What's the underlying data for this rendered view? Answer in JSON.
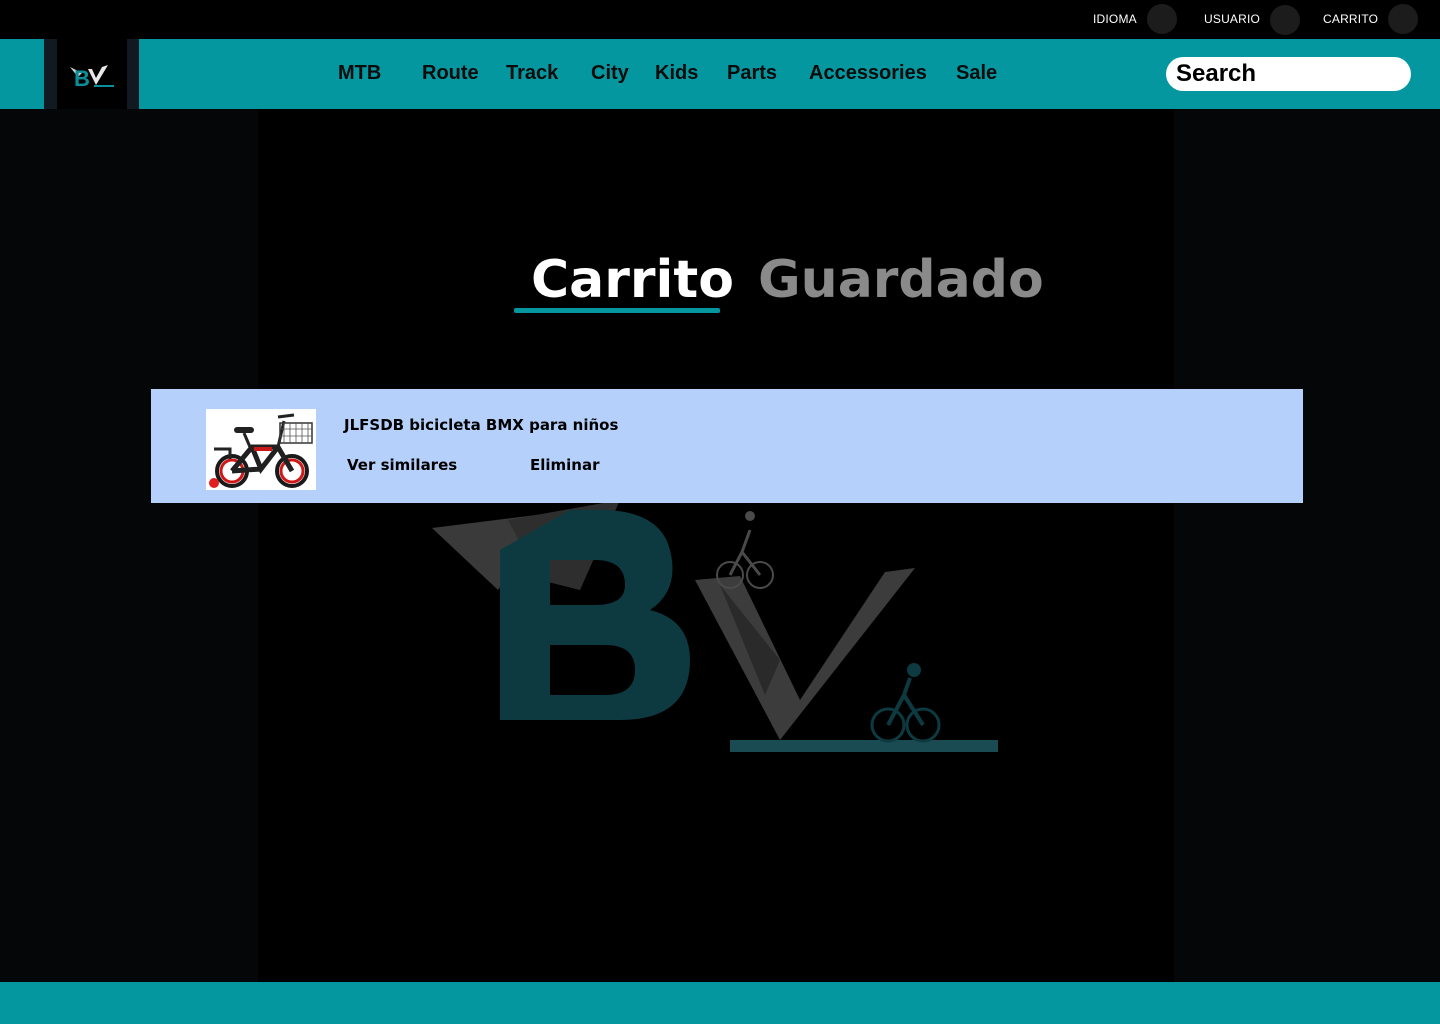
{
  "utility_bar": {
    "language_label": "IDIOMA",
    "user_label": "USUARIO",
    "cart_label": "CARRITO"
  },
  "nav": {
    "logo_icon": "bv-logo-icon",
    "links": [
      "MTB",
      "Route",
      "Track",
      "City",
      "Kids",
      "Parts",
      "Accessories",
      "Sale"
    ],
    "search_placeholder": "Search"
  },
  "tabs": {
    "cart": "Carrito",
    "saved": "Guardado",
    "active": "cart"
  },
  "cart_items": [
    {
      "name": "JLFSDB bicicleta BMX para niños",
      "image_icon": "kids-bike-image",
      "actions": {
        "similar": "Ver similares",
        "remove": "Eliminar"
      }
    }
  ],
  "colors": {
    "accent": "#05979f",
    "panel": "#b4d0fb",
    "background": "#000000",
    "inactive_tab": "#8a8a8a"
  }
}
